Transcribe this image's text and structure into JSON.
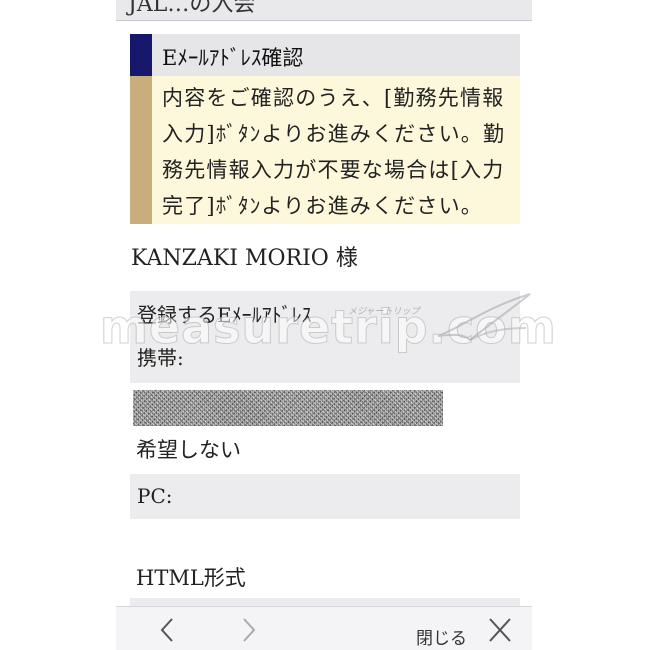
{
  "header": {
    "title_partial": "JAL…の入会"
  },
  "section": {
    "title": "Eﾒｰﾙｱﾄﾞﾚｽ確認"
  },
  "notice": {
    "text": "内容をご確認のうえ、[勤務先情報入力]ﾎﾞﾀﾝよりお進みください。勤務先情報入力が不要な場合は[入力完了]ﾎﾞﾀﾝよりお進みください。"
  },
  "user": {
    "name": "KANZAKI MORIO 様"
  },
  "email": {
    "register_label": "登録するEﾒｰﾙｱﾄﾞﾚｽ",
    "mobile_label": "携帯:",
    "mobile_value": "",
    "mobile_preference": "希望しない",
    "pc_label": "PC:",
    "pc_value": "",
    "format_label": "HTML形式"
  },
  "watermark": {
    "text": "measuretrip.com",
    "small": "メジャートリップ"
  },
  "toolbar": {
    "back_icon": "chevron-left-icon",
    "forward_icon": "chevron-right-icon",
    "close_label": "閉じる",
    "close_icon": "close-icon"
  }
}
